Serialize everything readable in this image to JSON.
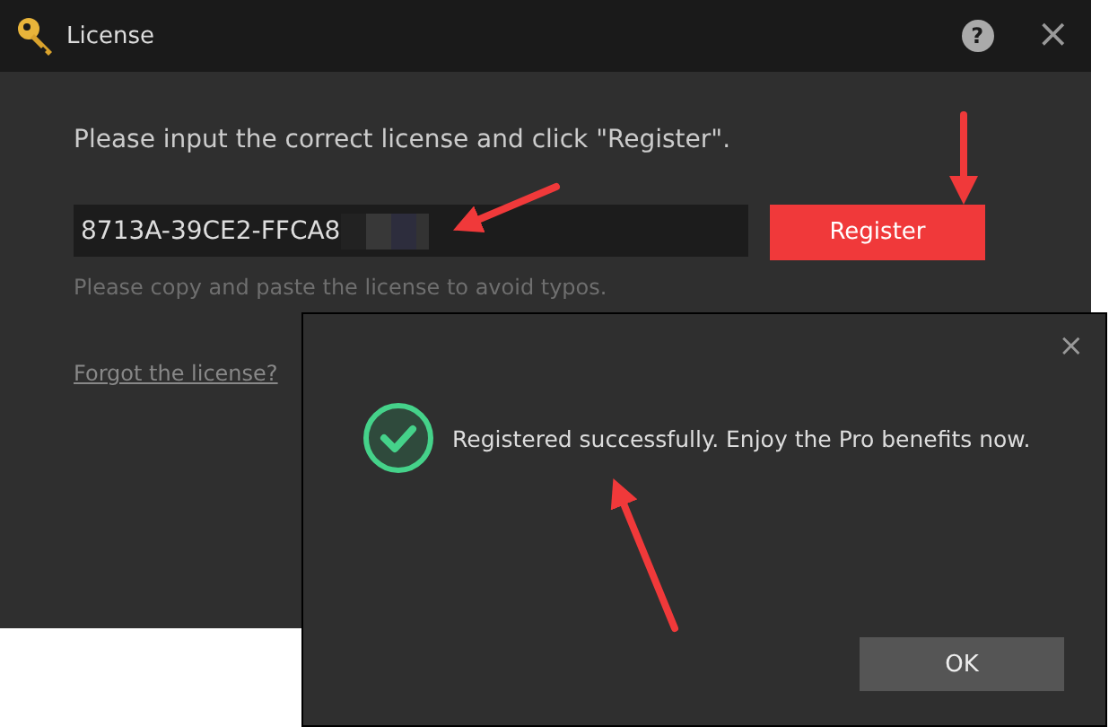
{
  "window": {
    "title": "License",
    "help": "?",
    "close": "×"
  },
  "instruction": "Please input the correct license and click \"Register\".",
  "license_field": {
    "value": "8713A-39CE2-FFCA8"
  },
  "register_button": "Register",
  "hint": "Please copy and paste the license to avoid typos.",
  "forgot_link": "Forgot the license?",
  "dialog": {
    "close": "×",
    "message": "Registered successfully. Enjoy the Pro benefits now.",
    "ok_button": "OK"
  }
}
